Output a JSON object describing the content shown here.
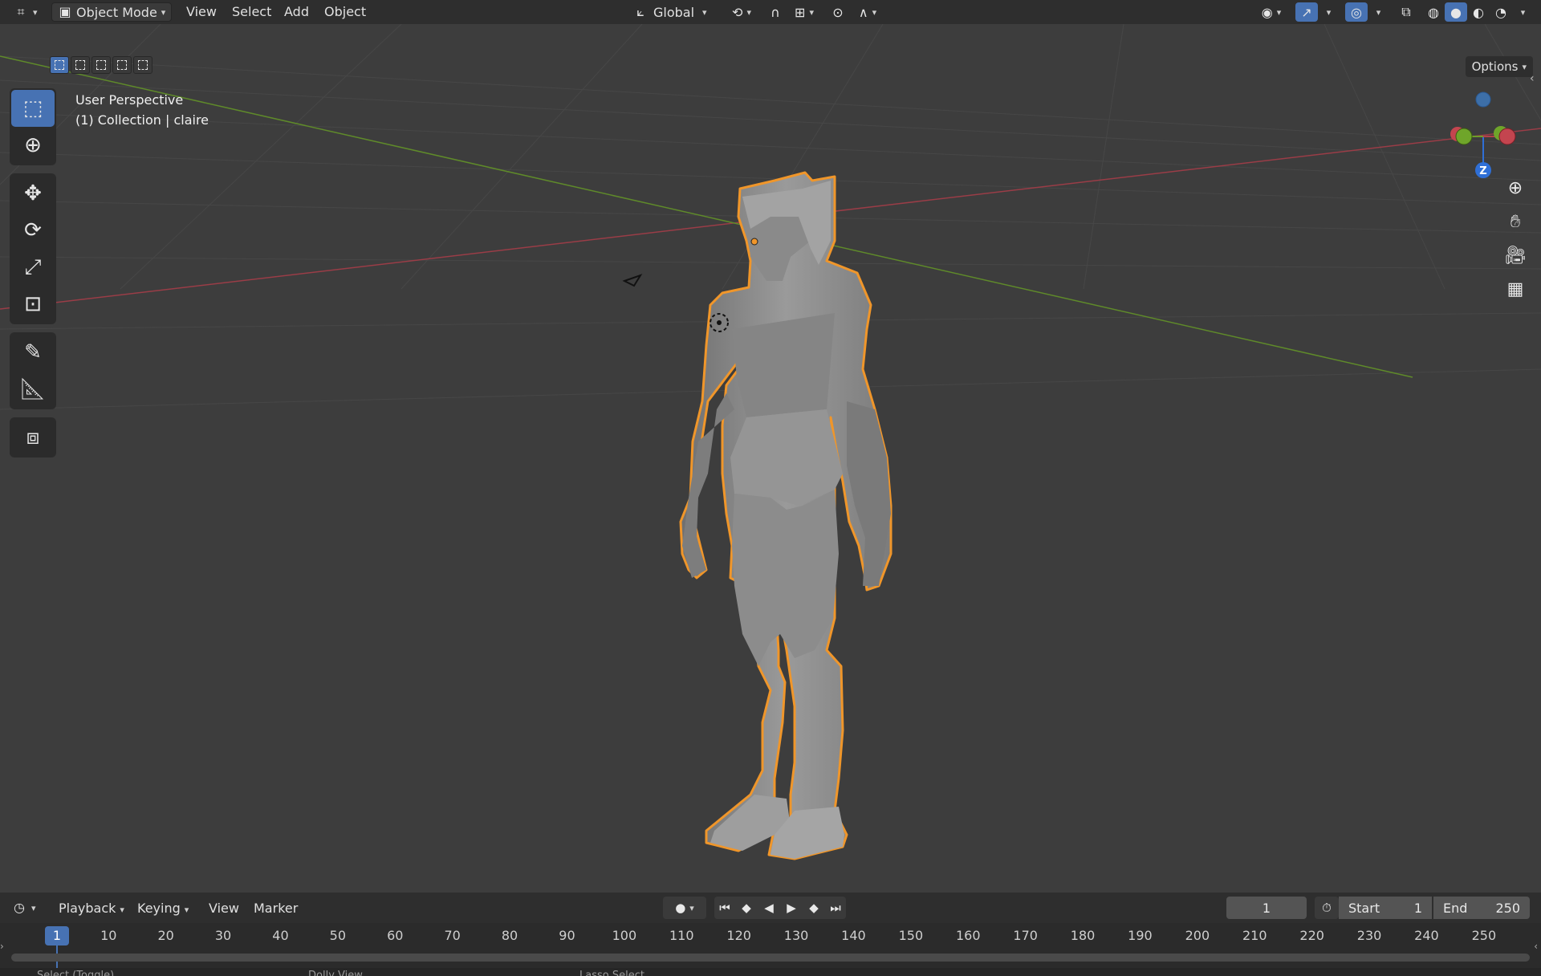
{
  "header": {
    "mode_label": "Object Mode",
    "menus": [
      "View",
      "Select",
      "Add",
      "Object"
    ],
    "transform_orientation": "Global",
    "options_label": "Options"
  },
  "viewport": {
    "view_name": "User Perspective",
    "collection_info": "(1) Collection | claire",
    "gizmo_axis_label": "Z"
  },
  "toolbar": {
    "tools": [
      "select-box",
      "cursor",
      "move",
      "rotate",
      "scale",
      "transform",
      "annotate",
      "measure",
      "add-cube"
    ]
  },
  "timeline": {
    "menus": [
      "Playback",
      "Keying",
      "View",
      "Marker"
    ],
    "current_frame": "1",
    "start_label": "Start",
    "start_value": "1",
    "end_label": "End",
    "end_value": "250",
    "ticks": [
      "1",
      "10",
      "20",
      "30",
      "40",
      "50",
      "60",
      "70",
      "80",
      "90",
      "100",
      "110",
      "120",
      "130",
      "140",
      "150",
      "160",
      "170",
      "180",
      "190",
      "200",
      "210",
      "220",
      "230",
      "240",
      "250"
    ]
  },
  "statusbar": {
    "items": [
      "Select (Toggle)",
      "Dolly View",
      "Lasso Select"
    ]
  },
  "colors": {
    "accent": "#4772b3",
    "selection_outline": "#f0962a",
    "x_axis": "#b2404b",
    "y_axis": "#6f9c2a"
  }
}
